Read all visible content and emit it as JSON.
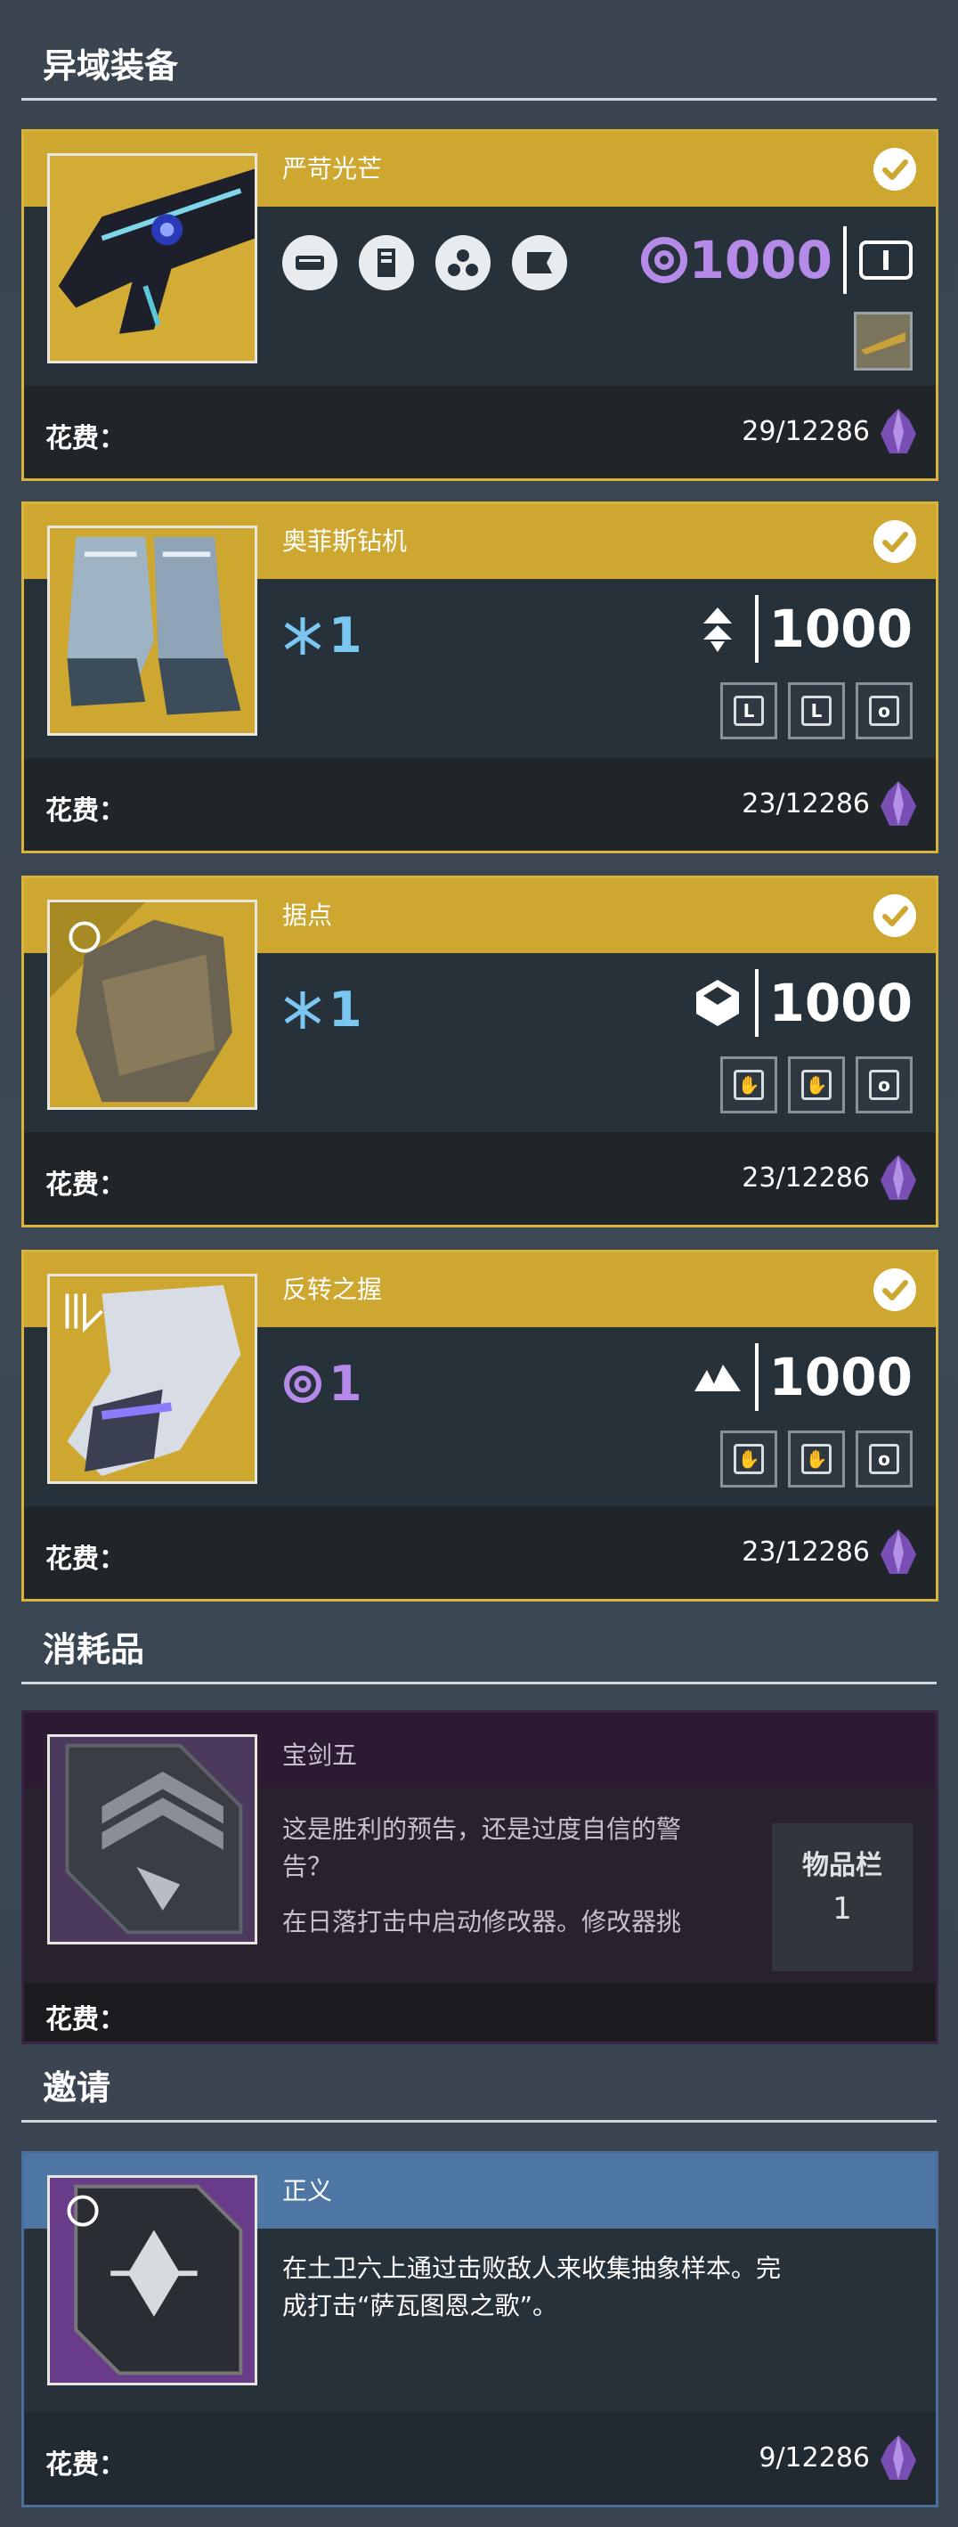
{
  "sections": {
    "exotic": "异域装备",
    "consumables": "消耗品",
    "invitations": "邀请"
  },
  "cost_label": "花费：",
  "items": [
    {
      "title": "严苛光芒",
      "power": "1000",
      "cost": "29/12286",
      "perk_icons": [
        "barrel-icon",
        "magazine-icon",
        "frame-icon",
        "stock-icon"
      ],
      "ammo_icon": "special-ammo-icon"
    },
    {
      "title": "奥菲斯钻机",
      "element_value": "1",
      "element_icon": "arc-icon",
      "class_icon": "hunter-icon",
      "power": "1000",
      "mods": [
        "L",
        "L",
        "o"
      ],
      "cost": "23/12286"
    },
    {
      "title": "据点",
      "element_value": "1",
      "element_icon": "arc-icon",
      "class_icon": "titan-icon",
      "power": "1000",
      "mods": [
        "✋",
        "✋",
        "o"
      ],
      "cost": "23/12286"
    },
    {
      "title": "反转之握",
      "element_value": "1",
      "element_icon": "void-icon",
      "class_icon": "warlock-icon",
      "power": "1000",
      "mods": [
        "✋",
        "✋",
        "o"
      ],
      "cost": "23/12286"
    }
  ],
  "consumable": {
    "title": "宝剑五",
    "desc1": "这是胜利的预告，还是过度自信的警",
    "desc2": "告？",
    "desc3": "在日落打击中启动修改器。修改器挑",
    "inventory_label": "物品栏",
    "inventory_count": "1"
  },
  "invitation": {
    "title": "正义",
    "desc1": "在土卫六上通过击败敌人来收集抽象样本。完",
    "desc2": "成打击“萨瓦图恩之歌”。",
    "cost": "9/12286"
  },
  "colors": {
    "gold": "#cda72f",
    "void_purple": "#b58ae8",
    "arc_blue": "#7cc6f2",
    "blue_header": "#4f77a6"
  }
}
